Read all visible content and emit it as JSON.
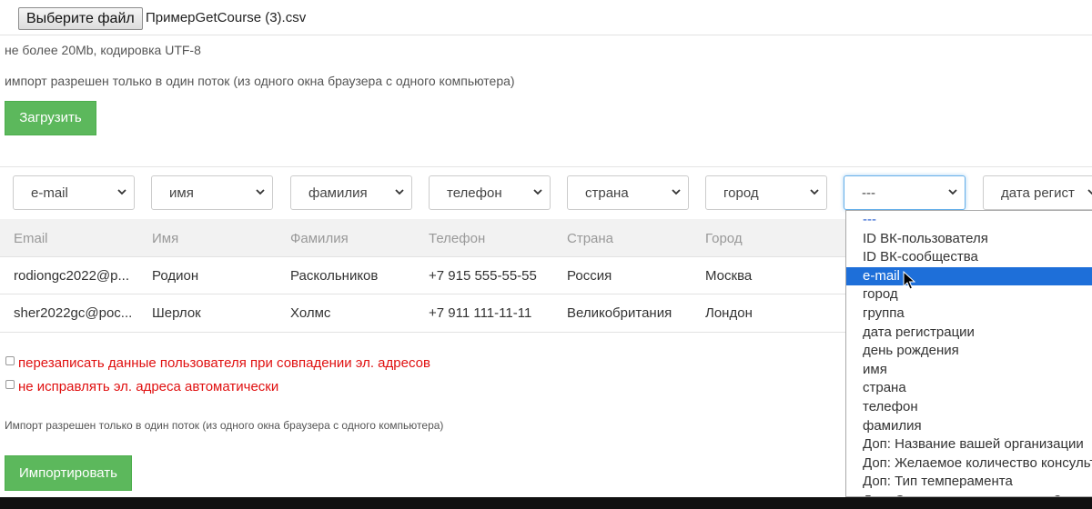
{
  "file": {
    "button_label": "Выберите файл",
    "file_name": "ПримерGetCourse (3).csv"
  },
  "hints": {
    "size": "не более 20Mb, кодировка UTF-8",
    "thread": "импорт разрешен только в один поток (из одного окна браузера с одного компьютера)",
    "thread_bottom": "Импорт разрешен только в один поток (из одного окна браузера с одного компьютера)"
  },
  "buttons": {
    "upload": "Загрузить",
    "import": "Импортировать"
  },
  "column_selects": [
    {
      "value": "e-mail"
    },
    {
      "value": "имя"
    },
    {
      "value": "фамилия"
    },
    {
      "value": "телефон"
    },
    {
      "value": "страна"
    },
    {
      "value": "город"
    },
    {
      "value": "---"
    },
    {
      "value": "дата регист"
    }
  ],
  "table": {
    "headers": [
      "Email",
      "Имя",
      "Фамилия",
      "Телефон",
      "Страна",
      "Город"
    ],
    "rows": [
      [
        "rodiongc2022@p...",
        "Родион",
        "Раскольников",
        "+7 915 555-55-55",
        "Россия",
        "Москва"
      ],
      [
        "sher2022gc@poc...",
        "Шерлок",
        "Холмс",
        "+7 911 111-11-11",
        "Великобритания",
        "Лондон"
      ]
    ]
  },
  "options": {
    "overwrite": "перезаписать данные пользователя при совпадении эл. адресов",
    "no_fix": "не исправлять эл. адреса автоматически"
  },
  "dropdown": {
    "items": [
      "---",
      "ID ВК-пользователя",
      "ID ВК-сообщества",
      "e-mail",
      "город",
      "группа",
      "дата регистрации",
      "день рождения",
      "имя",
      "страна",
      "телефон",
      "фамилия",
      "Доп: Название вашей организации",
      "Доп: Желаемое количество консультаций",
      "Доп: Тип темперамента",
      "Доп: Сколько денег вы несете?"
    ],
    "highlighted": "e-mail"
  },
  "colors": {
    "green": "#5cb85c",
    "highlight": "#1e6fd9",
    "warning": "#e01010"
  }
}
